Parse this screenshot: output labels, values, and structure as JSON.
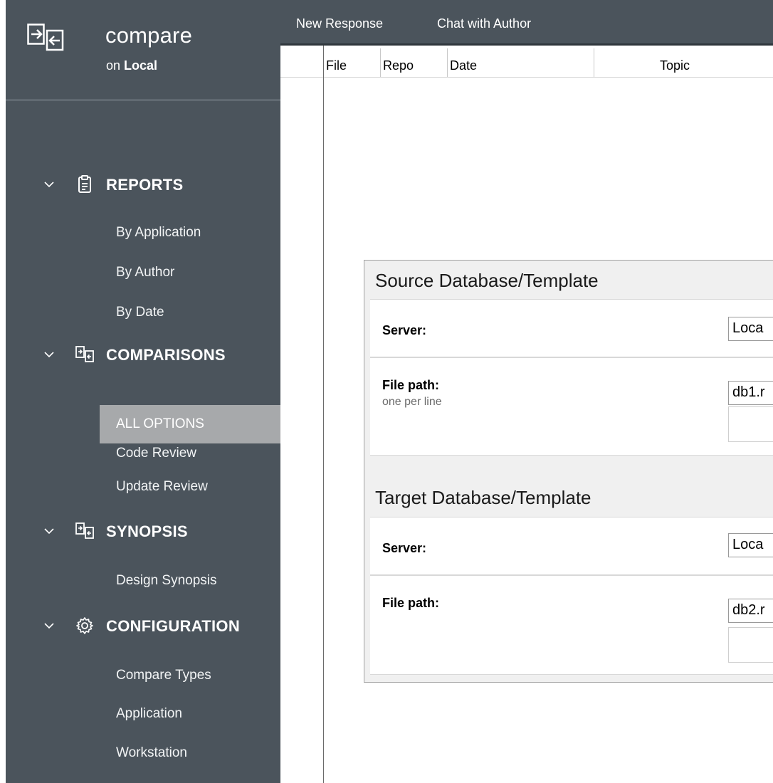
{
  "app": {
    "title": "compare",
    "subtitle_prefix": "on",
    "subtitle_target": "Local"
  },
  "sidebar": {
    "sections": [
      {
        "label": "REPORTS",
        "icon": "clipboard-icon",
        "items": [
          "By Application",
          "By Author",
          "By Date"
        ]
      },
      {
        "label": "COMPARISONS",
        "icon": "compare-icon",
        "items": [
          "ALL OPTIONS",
          "Code Review",
          "Update Review"
        ],
        "active": "ALL OPTIONS"
      },
      {
        "label": "SYNOPSIS",
        "icon": "compare-icon",
        "items": [
          "Design Synopsis"
        ]
      },
      {
        "label": "CONFIGURATION",
        "icon": "gear-icon",
        "items": [
          "Compare Types",
          "Application",
          "Workstation"
        ]
      }
    ]
  },
  "toolbar": {
    "menu": [
      "New Response",
      "Chat with Author"
    ]
  },
  "grid": {
    "columns": [
      "File",
      "Repo",
      "Date",
      "Topic"
    ]
  },
  "panel": {
    "source": {
      "title": "Source Database/Template",
      "server_label": "Server:",
      "server_value": "Loca",
      "filepath_label": "File path:",
      "filepath_hint": "one per line",
      "filepath_value": "db1.r"
    },
    "target": {
      "title": "Target Database/Template",
      "server_label": "Server:",
      "server_value": "Loca",
      "filepath_label": "File path:",
      "filepath_value": "db2.r"
    }
  },
  "colors": {
    "sidebar_bg": "#4b545c",
    "active_item_bg": "#a7a9ab",
    "panel_bg": "#f0f0f0"
  }
}
